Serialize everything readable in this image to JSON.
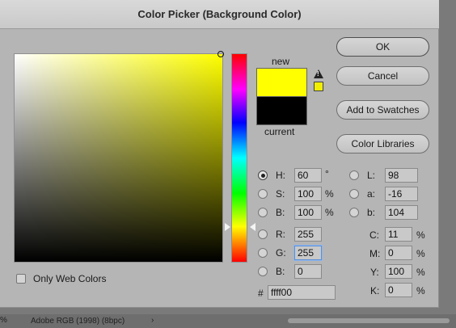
{
  "dialog": {
    "title": "Color Picker (Background Color)",
    "labels": {
      "new": "new",
      "current": "current"
    },
    "new_color": "#ffff00",
    "current_color": "#000000",
    "buttons": {
      "ok": "OK",
      "cancel": "Cancel",
      "add_to_swatches": "Add to Swatches",
      "color_libraries": "Color Libraries"
    },
    "hsb": {
      "h": {
        "label": "H:",
        "value": "60",
        "unit": "°"
      },
      "s": {
        "label": "S:",
        "value": "100",
        "unit": "%"
      },
      "b": {
        "label": "B:",
        "value": "100",
        "unit": "%"
      }
    },
    "rgb": {
      "r": {
        "label": "R:",
        "value": "255"
      },
      "g": {
        "label": "G:",
        "value": "255"
      },
      "b": {
        "label": "B:",
        "value": "0"
      }
    },
    "lab": {
      "l": {
        "label": "L:",
        "value": "98"
      },
      "a": {
        "label": "a:",
        "value": "-16"
      },
      "b": {
        "label": "b:",
        "value": "104"
      }
    },
    "cmyk": {
      "c": {
        "label": "C:",
        "value": "11",
        "unit": "%"
      },
      "m": {
        "label": "M:",
        "value": "0",
        "unit": "%"
      },
      "y": {
        "label": "Y:",
        "value": "100",
        "unit": "%"
      },
      "k": {
        "label": "K:",
        "value": "0",
        "unit": "%"
      }
    },
    "hex": {
      "label": "#",
      "value": "ffff00"
    },
    "only_web_colors": {
      "label": "Only Web Colors",
      "checked": false
    },
    "selected_component": "H"
  },
  "statusbar": {
    "zoom_fragment": "%",
    "doc_profile": "Adobe RGB (1998) (8bpc)",
    "arrow": "›"
  }
}
